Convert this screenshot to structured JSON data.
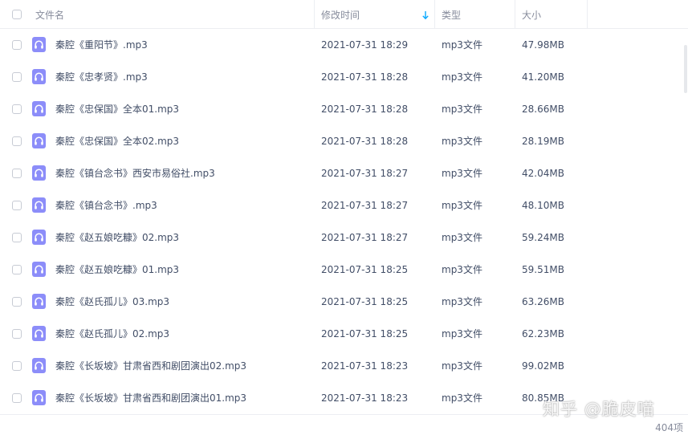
{
  "header": {
    "name_label": "文件名",
    "time_label": "修改时间",
    "type_label": "类型",
    "size_label": "大小"
  },
  "rows": [
    {
      "name": "秦腔《重阳节》.mp3",
      "time": "2021-07-31 18:29",
      "type": "mp3文件",
      "size": "47.98MB"
    },
    {
      "name": "秦腔《忠孝贤》.mp3",
      "time": "2021-07-31 18:28",
      "type": "mp3文件",
      "size": "41.20MB"
    },
    {
      "name": "秦腔《忠保国》全本01.mp3",
      "time": "2021-07-31 18:28",
      "type": "mp3文件",
      "size": "28.66MB"
    },
    {
      "name": "秦腔《忠保国》全本02.mp3",
      "time": "2021-07-31 18:28",
      "type": "mp3文件",
      "size": "28.19MB"
    },
    {
      "name": "秦腔《镇台念书》西安市易俗社.mp3",
      "time": "2021-07-31 18:27",
      "type": "mp3文件",
      "size": "42.04MB"
    },
    {
      "name": "秦腔《镇台念书》.mp3",
      "time": "2021-07-31 18:27",
      "type": "mp3文件",
      "size": "48.10MB"
    },
    {
      "name": "秦腔《赵五娘吃糠》02.mp3",
      "time": "2021-07-31 18:27",
      "type": "mp3文件",
      "size": "59.24MB"
    },
    {
      "name": "秦腔《赵五娘吃糠》01.mp3",
      "time": "2021-07-31 18:25",
      "type": "mp3文件",
      "size": "59.51MB"
    },
    {
      "name": "秦腔《赵氏孤儿》03.mp3",
      "time": "2021-07-31 18:25",
      "type": "mp3文件",
      "size": "63.26MB"
    },
    {
      "name": "秦腔《赵氏孤儿》02.mp3",
      "time": "2021-07-31 18:25",
      "type": "mp3文件",
      "size": "62.23MB"
    },
    {
      "name": "秦腔《长坂坡》甘肃省西和剧团演出02.mp3",
      "time": "2021-07-31 18:23",
      "type": "mp3文件",
      "size": "99.02MB"
    },
    {
      "name": "秦腔《长坂坡》甘肃省西和剧团演出01.mp3",
      "time": "2021-07-31 18:23",
      "type": "mp3文件",
      "size": "80.85MB"
    }
  ],
  "footer": {
    "count": "404项"
  },
  "watermark": "知乎 @脆皮喵",
  "icons": {
    "file": "audio-file-icon",
    "sort": "sort-down-arrow-icon"
  },
  "colors": {
    "accent": "#06a7ff",
    "file_icon": "#8c8df9",
    "text": "#424e67",
    "muted": "#878c9c"
  }
}
